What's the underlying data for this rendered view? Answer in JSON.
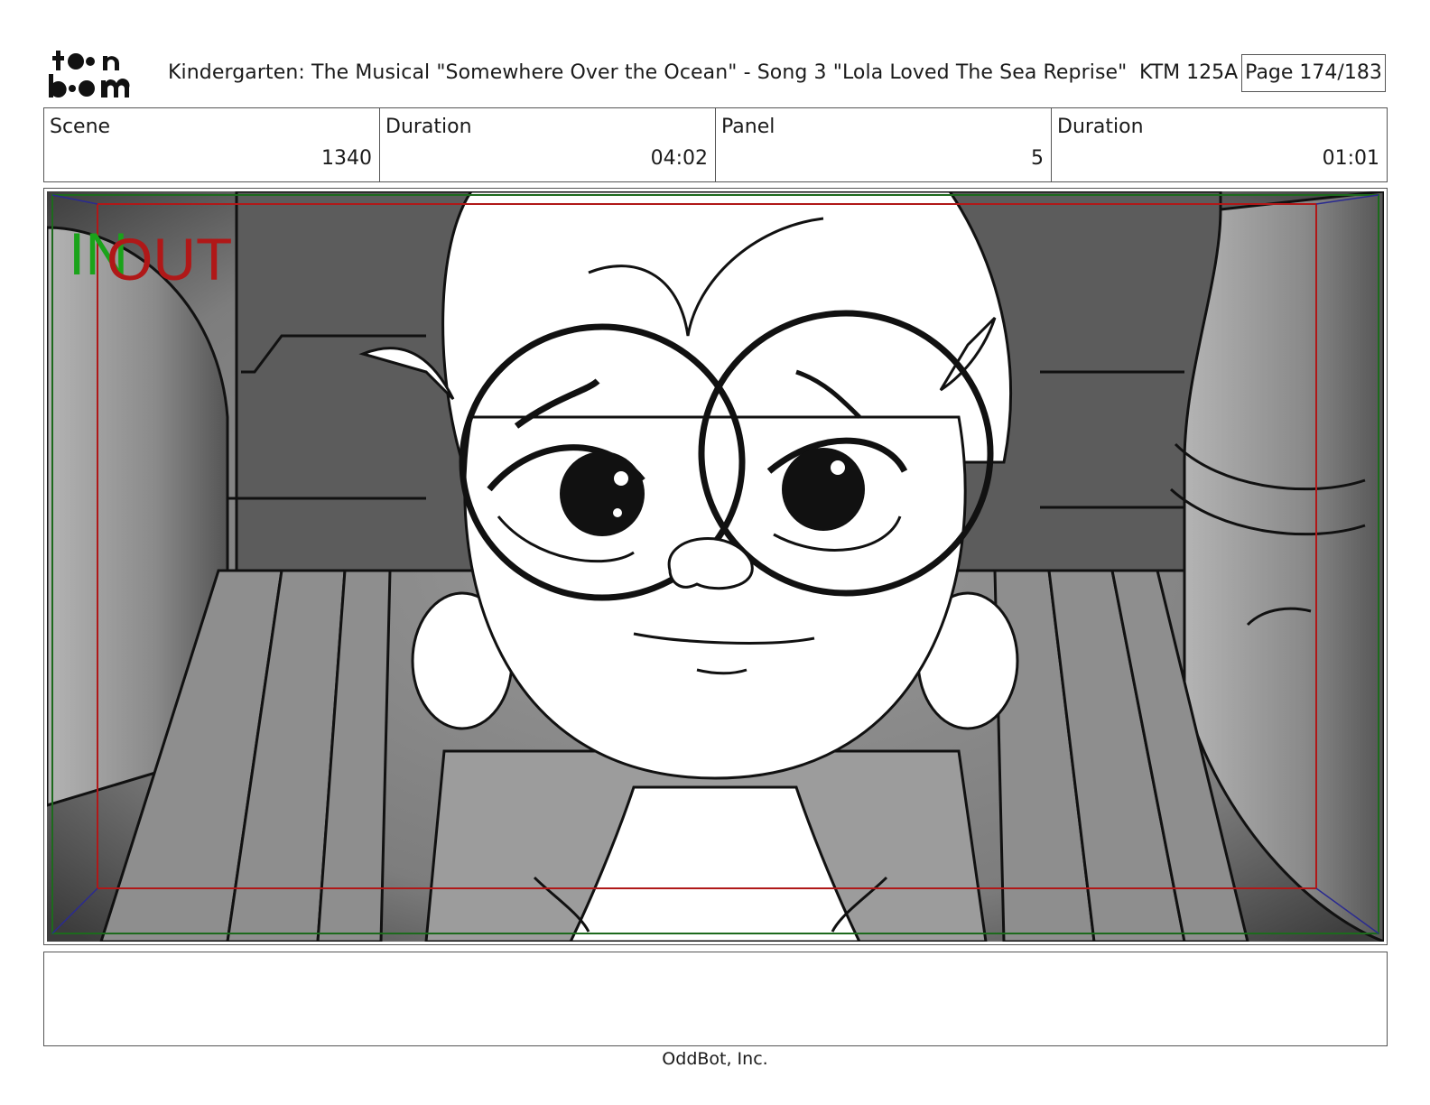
{
  "header": {
    "logo_text_top": "toon",
    "logo_text_bottom": "boom",
    "title": "Kindergarten: The Musical  \"Somewhere Over the Ocean\" - Song 3 \"Lola Loved The Sea Reprise\"",
    "episode_code": "KTM 125A",
    "page": "Page 174/183"
  },
  "info": {
    "scene_label": "Scene",
    "scene_value": "1340",
    "scene_duration_label": "Duration",
    "scene_duration_value": "04:02",
    "panel_label": "Panel",
    "panel_value": "5",
    "panel_duration_label": "Duration",
    "panel_duration_value": "01:01"
  },
  "frame": {
    "in_label": "IN",
    "out_label": "OUT",
    "in_color": "#1aa31a",
    "out_color": "#b01818"
  },
  "notes": "",
  "footer": "OddBot, Inc."
}
